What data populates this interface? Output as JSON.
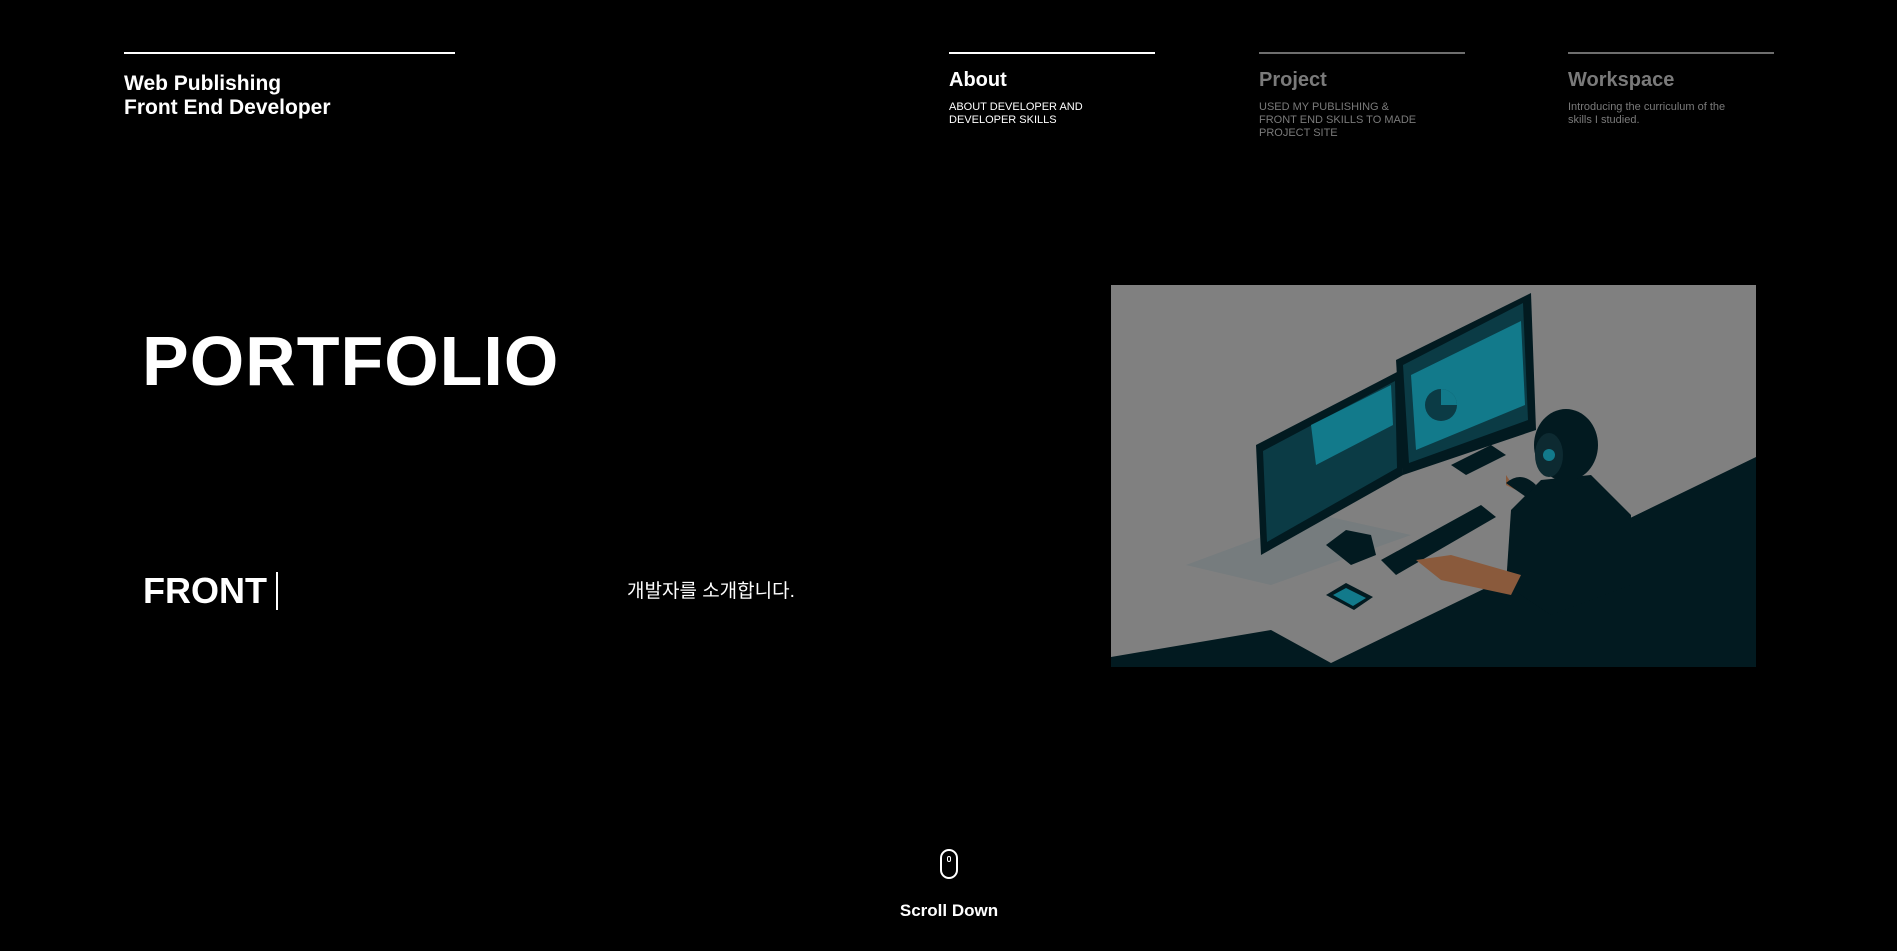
{
  "brand": {
    "line1": "Web Publishing",
    "line2": "Front End Developer"
  },
  "nav": [
    {
      "title": "About",
      "desc": "ABOUT DEVELOPER AND DEVELOPER SKILLS",
      "active": true
    },
    {
      "title": "Project",
      "desc": "USED MY PUBLISHING & FRONT END SKILLS TO MADE PROJECT SITE",
      "active": false
    },
    {
      "title": "Workspace",
      "desc": "Introducing the curriculum of the skills I studied.",
      "active": false
    }
  ],
  "hero": {
    "title": "PORTFOLIO",
    "typed_word": "FRONT",
    "intro": "개발자를 소개합니다."
  },
  "illustration": {
    "icon": "developer-at-desk-illustration",
    "colors": {
      "background": "#808080",
      "dark": "#021a20",
      "accent": "#0f7a8c",
      "skin": "#8a5a3c"
    }
  },
  "scroll": {
    "icon": "mouse-icon",
    "label": "Scroll Down"
  },
  "colors": {
    "background": "#000000",
    "text": "#ffffff",
    "muted": "#7a7a7a"
  }
}
